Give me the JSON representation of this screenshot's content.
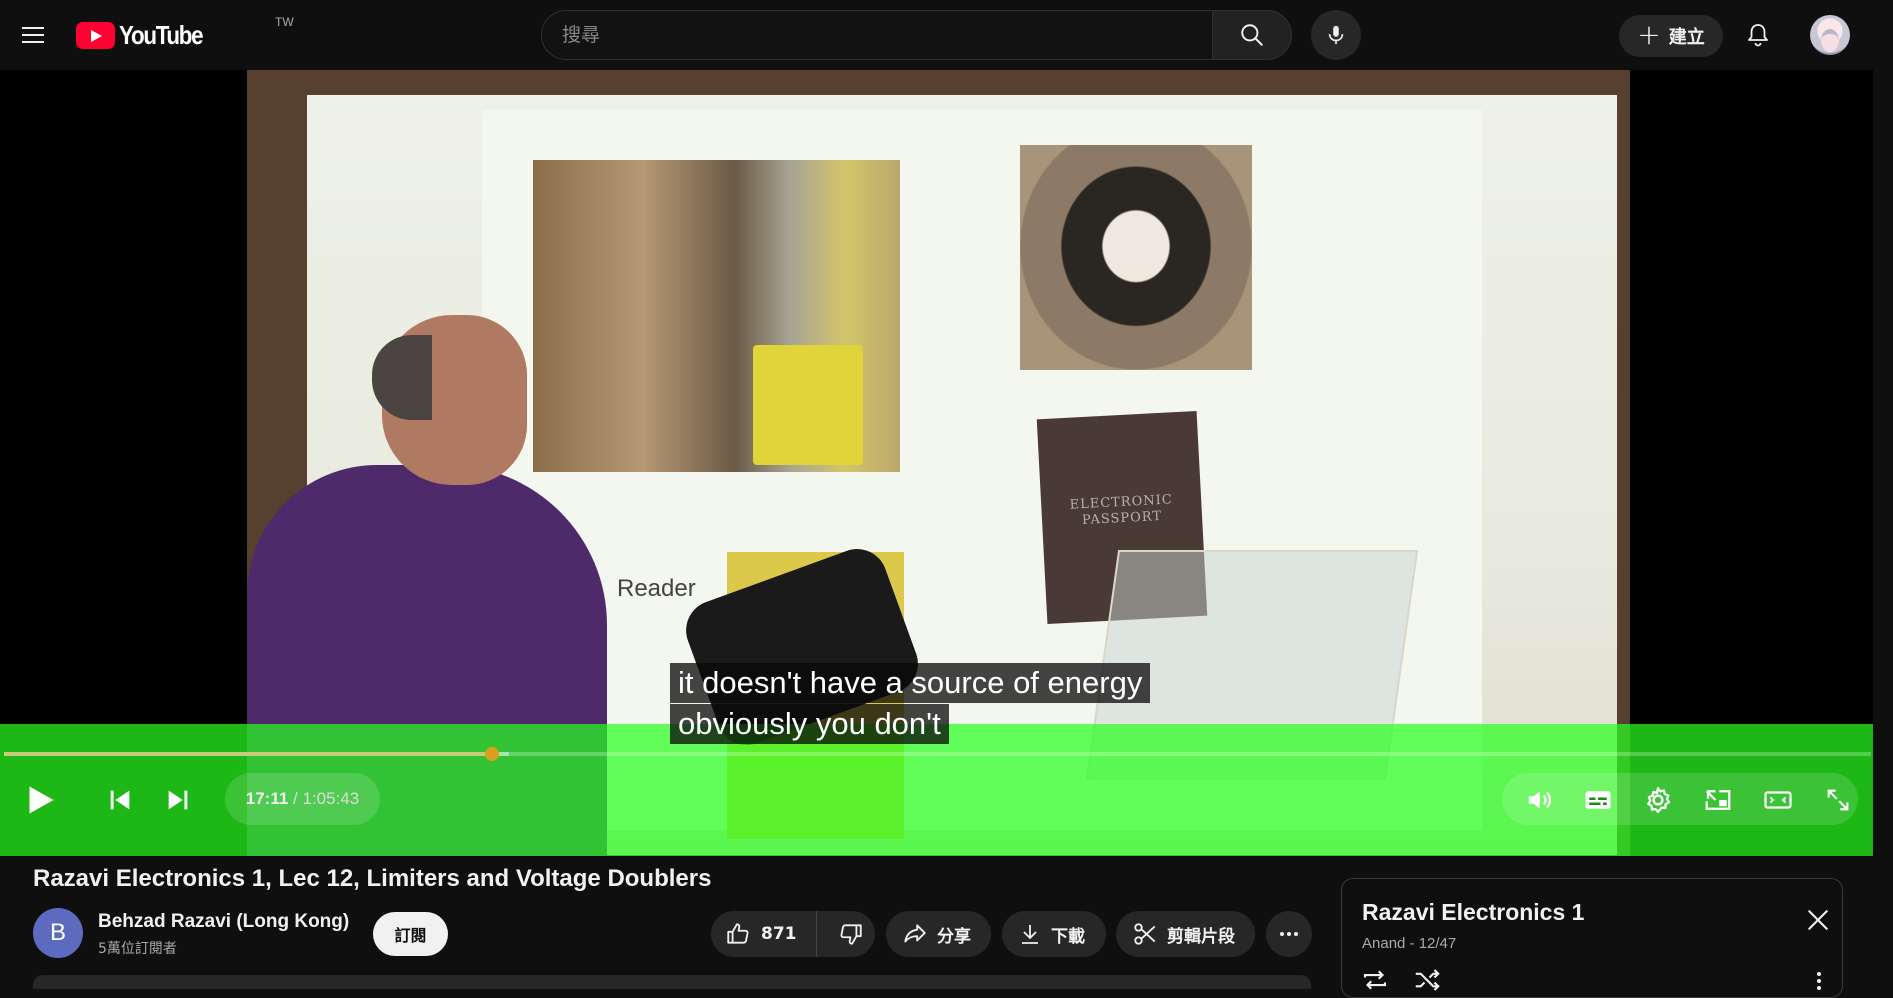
{
  "header": {
    "logo_word": "YouTube",
    "region": "TW",
    "search_placeholder": "搜尋",
    "create_label": "建立",
    "icons": [
      "menu-icon",
      "search-icon",
      "mic-icon",
      "plus-icon",
      "bell-icon"
    ]
  },
  "video_frame": {
    "slide_label": "Reader",
    "passport_text": "ELECTRONIC PASSPORT"
  },
  "player": {
    "caption_line1": "it doesn't have a source of energy",
    "caption_line2": "obviously you don't",
    "current_time": "17:11",
    "separator": " / ",
    "duration": "1:05:43",
    "progress_fraction": 0.2615,
    "overlay_color": "#28ff1e",
    "icons": [
      "play-icon",
      "previous-icon",
      "next-icon",
      "volume-icon",
      "subtitles-icon",
      "settings-icon",
      "miniplayer-icon",
      "theater-mode-icon",
      "fullscreen-icon"
    ]
  },
  "video": {
    "title": "Razavi Electronics 1, Lec 12, Limiters and Voltage Doublers",
    "channel_initial": "B",
    "channel_name": "Behzad Razavi (Long Kong)",
    "subscriber_count": "5萬位訂閱者",
    "subscribe_label": "訂閱",
    "like_count": "871",
    "share_label": "分享",
    "download_label": "下載",
    "clip_label": "剪輯片段"
  },
  "playlist": {
    "title": "Razavi Electronics 1",
    "meta": "Anand - 12/47"
  },
  "colors": {
    "background": "#0f0f0f",
    "youtube_red": "#ff0033",
    "chip": "#272727"
  }
}
